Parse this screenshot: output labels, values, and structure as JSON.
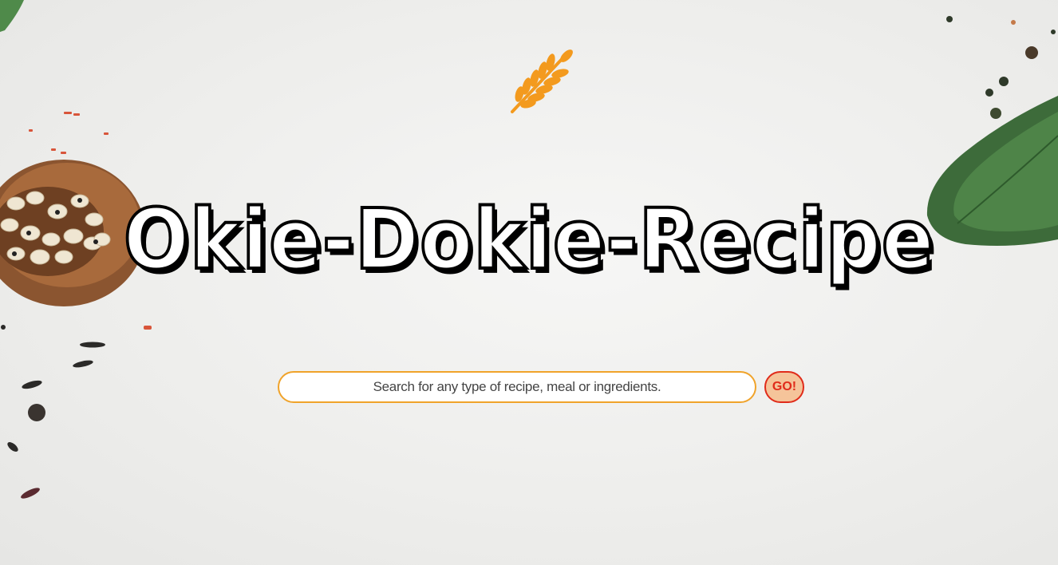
{
  "brand": {
    "title": "Okie-Dokie-Recipe",
    "logo_icon": "wheat-icon",
    "logo_color": "#f39a1e"
  },
  "search": {
    "placeholder": "Search for any type of recipe, meal or ingredients.",
    "value": "",
    "button_label": "GO!",
    "input_border_color": "#f0a32a",
    "button_color": "#e02b1a",
    "button_background": "#f5c49a"
  },
  "background": {
    "description_icons": [
      "bean-bowl-icon",
      "leaf-icon",
      "peppercorn-icon",
      "rice-grain-icon"
    ]
  }
}
